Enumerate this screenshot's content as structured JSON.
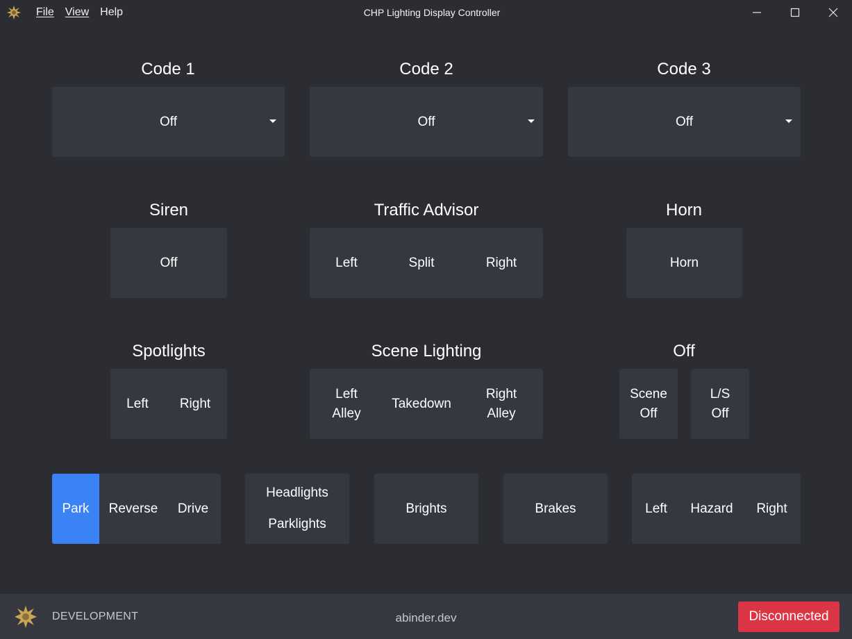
{
  "titlebar": {
    "title": "CHP Lighting Display Controller",
    "menu": [
      "File",
      "View",
      "Help"
    ]
  },
  "codes": [
    {
      "title": "Code 1",
      "value": "Off"
    },
    {
      "title": "Code 2",
      "value": "Off"
    },
    {
      "title": "Code 3",
      "value": "Off"
    }
  ],
  "siren": {
    "title": "Siren",
    "button": "Off"
  },
  "traffic_advisor": {
    "title": "Traffic Advisor",
    "buttons": [
      "Left",
      "Split",
      "Right"
    ]
  },
  "horn": {
    "title": "Horn",
    "button": "Horn"
  },
  "spotlights": {
    "title": "Spotlights",
    "buttons": [
      "Left",
      "Right"
    ]
  },
  "scene_lighting": {
    "title": "Scene Lighting",
    "left": [
      "Left",
      "Alley"
    ],
    "center": "Takedown",
    "right": [
      "Right",
      "Alley"
    ]
  },
  "off_group": {
    "title": "Off",
    "scene": [
      "Scene",
      "Off"
    ],
    "ls": [
      "L/S",
      "Off"
    ]
  },
  "gear": {
    "options": [
      "Park",
      "Reverse",
      "Drive"
    ],
    "selected": "Park"
  },
  "lights": {
    "headlights": "Headlights",
    "parklights": "Parklights",
    "brights": "Brights",
    "brakes": "Brakes"
  },
  "signals": {
    "buttons": [
      "Left",
      "Hazard",
      "Right"
    ]
  },
  "footer": {
    "environment": "DEVELOPMENT",
    "host": "abinder.dev",
    "status": "Disconnected"
  },
  "colors": {
    "background": "#2b2d33",
    "panel": "#353840",
    "active": "#3b82f6",
    "danger": "#dc3545",
    "logo": "#c9a654"
  }
}
